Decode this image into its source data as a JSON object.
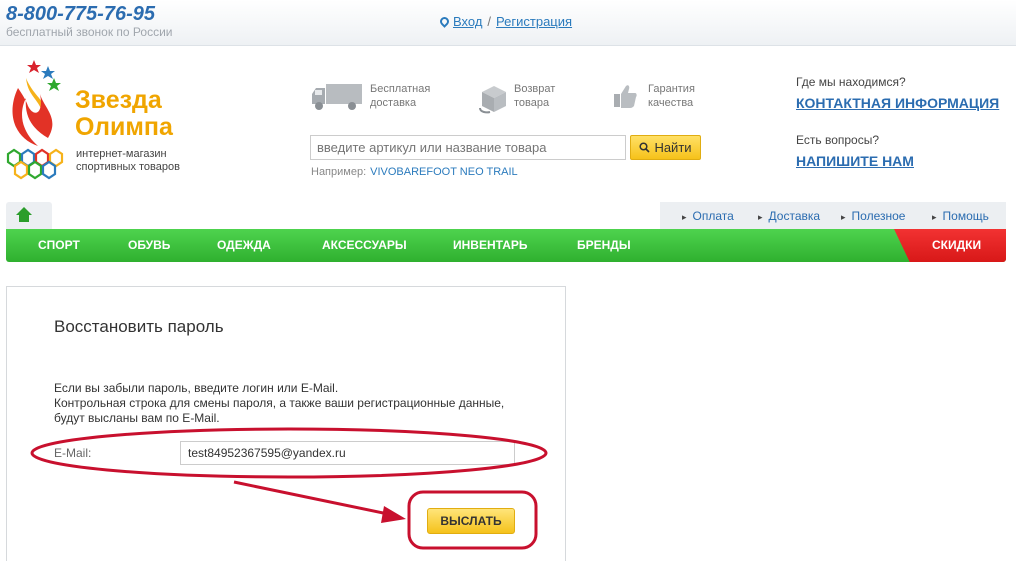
{
  "header": {
    "phone": "8-800-775-76-95",
    "phone_note": "бесплатный звонок по России",
    "login": "Вход",
    "separator": "/",
    "register": "Регистрация"
  },
  "logo": {
    "name_line1": "Звезда",
    "name_line2": "Олимпа",
    "tagline_line1": "интернет-магазин",
    "tagline_line2": "спортивных товаров"
  },
  "features": [
    {
      "icon": "truck-icon",
      "line1": "Бесплатная",
      "line2": "доставка"
    },
    {
      "icon": "return-box-icon",
      "line1": "Возврат",
      "line2": "товара"
    },
    {
      "icon": "thumbs-up-icon",
      "line1": "Гарантия",
      "line2": "качества"
    }
  ],
  "search": {
    "placeholder": "введите артикул или название товара",
    "button": "Найти",
    "example_label": "Например:",
    "example_link": "VIVOBAREFOOT NEO TRAIL"
  },
  "contact": {
    "where_label": "Где мы находимся?",
    "where_link": "КОНТАКТНАЯ ИНФОРМАЦИЯ",
    "questions_label": "Есть вопросы?",
    "questions_link": "НАПИШИТЕ НАМ"
  },
  "secondary_nav": [
    "Оплата",
    "Доставка",
    "Полезное",
    "Помощь"
  ],
  "main_nav": [
    "СПОРТ",
    "ОБУВЬ",
    "ОДЕЖДА",
    "АКСЕССУАРЫ",
    "ИНВЕНТАРЬ",
    "БРЕНДЫ"
  ],
  "sale_label": "СКИДКИ",
  "form": {
    "title": "Восстановить пароль",
    "text_line1": "Если вы забыли пароль, введите логин или E-Mail.",
    "text_line2": "Контрольная строка для смены пароля, а также ваши регистрационные данные,",
    "text_line3": "будут высланы вам по E-Mail.",
    "email_label": "E-Mail:",
    "email_value": "test84952367595@yandex.ru",
    "submit": "ВЫСЛАТЬ"
  },
  "colors": {
    "nav_green": "#35b535",
    "sale_red": "#e02020",
    "button_yellow": "#f6c21a",
    "link_blue": "#2b6cb0",
    "annotation_red": "#c8102e"
  }
}
